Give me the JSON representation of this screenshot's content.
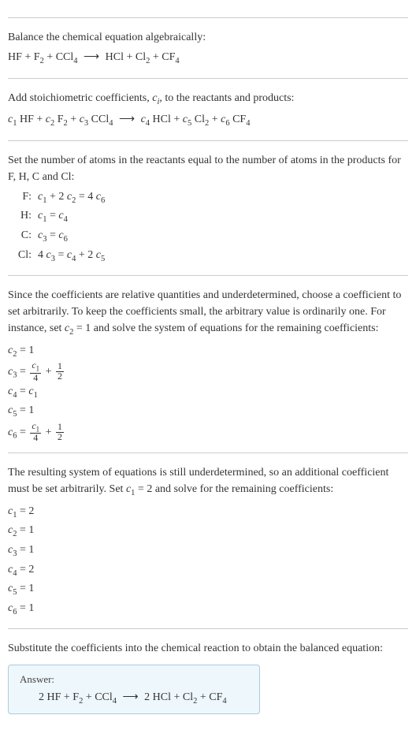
{
  "section1": {
    "line1": "Balance the chemical equation algebraically:",
    "eq_lhs1": "HF + F",
    "eq_lhs2": " + CCl",
    "arrow": "⟶",
    "eq_rhs1": "HCl + Cl",
    "eq_rhs2": " + CF"
  },
  "section2": {
    "line1_a": "Add stoichiometric coefficients, ",
    "c_i": "c",
    "i": "i",
    "line1_b": ", to the reactants and products:",
    "c1": "c",
    "s1": "1",
    "hf": " HF + ",
    "c2": "c",
    "s2": "2",
    "f2": " F",
    "plus": " + ",
    "c3": "c",
    "s3": "3",
    "ccl4": " CCl",
    "c4": "c",
    "s4": "4",
    "hcl": " HCl + ",
    "c5": "c",
    "s5": "5",
    "cl2": " Cl",
    "c6": "c",
    "s6": "6",
    "cf4": " CF"
  },
  "section3": {
    "line1": "Set the number of atoms in the reactants equal to the number of atoms in the products for F, H, C and Cl:",
    "rows": {
      "F": {
        "label": "F:",
        "eq_a": "c",
        "eq_b": " + 2 ",
        "eq_c": "c",
        "eq_d": " = 4 ",
        "eq_e": "c"
      },
      "H": {
        "label": "H:",
        "eq_a": "c",
        "eq_b": " = ",
        "eq_c": "c"
      },
      "C": {
        "label": "C:",
        "eq_a": "c",
        "eq_b": " = ",
        "eq_c": "c"
      },
      "Cl": {
        "label": "Cl:",
        "eq_a": "4 ",
        "eq_b": "c",
        "eq_c": " = ",
        "eq_d": "c",
        "eq_e": " + 2 ",
        "eq_f": "c"
      }
    }
  },
  "section4": {
    "line1_a": "Since the coefficients are relative quantities and underdetermined, choose a coefficient to set arbitrarily. To keep the coefficients small, the arbitrary value is ordinarily one. For instance, set ",
    "c2_eq": "c",
    "line1_b": " = 1 and solve the system of equations for the remaining coefficients:",
    "eq1": " = 1",
    "eq3_a": " = ",
    "eq3_plus": " + ",
    "frac_c1_num": "c",
    "frac_4": "4",
    "frac_1": "1",
    "frac_2": "2",
    "eq4_a": " = ",
    "eq5": " = 1"
  },
  "section5": {
    "line1_a": "The resulting system of equations is still underdetermined, so an additional coefficient must be set arbitrarily. Set ",
    "c1_eq": "c",
    "line1_b": " = 2 and solve for the remaining coefficients:",
    "vals": {
      "c1": " = 2",
      "c2": " = 1",
      "c3": " = 1",
      "c4": " = 2",
      "c5": " = 1",
      "c6": " = 1"
    }
  },
  "section6": {
    "line1": "Substitute the coefficients into the chemical reaction to obtain the balanced equation:",
    "answer_label": "Answer:",
    "eq_2hf": "2 HF + F",
    "eq_ccl4": " + CCl",
    "arrow": "⟶",
    "eq_2hcl": "2 HCl + Cl",
    "eq_cf4": " + CF"
  },
  "subs": {
    "n1": "1",
    "n2": "2",
    "n3": "3",
    "n4": "4",
    "n5": "5",
    "n6": "6"
  }
}
